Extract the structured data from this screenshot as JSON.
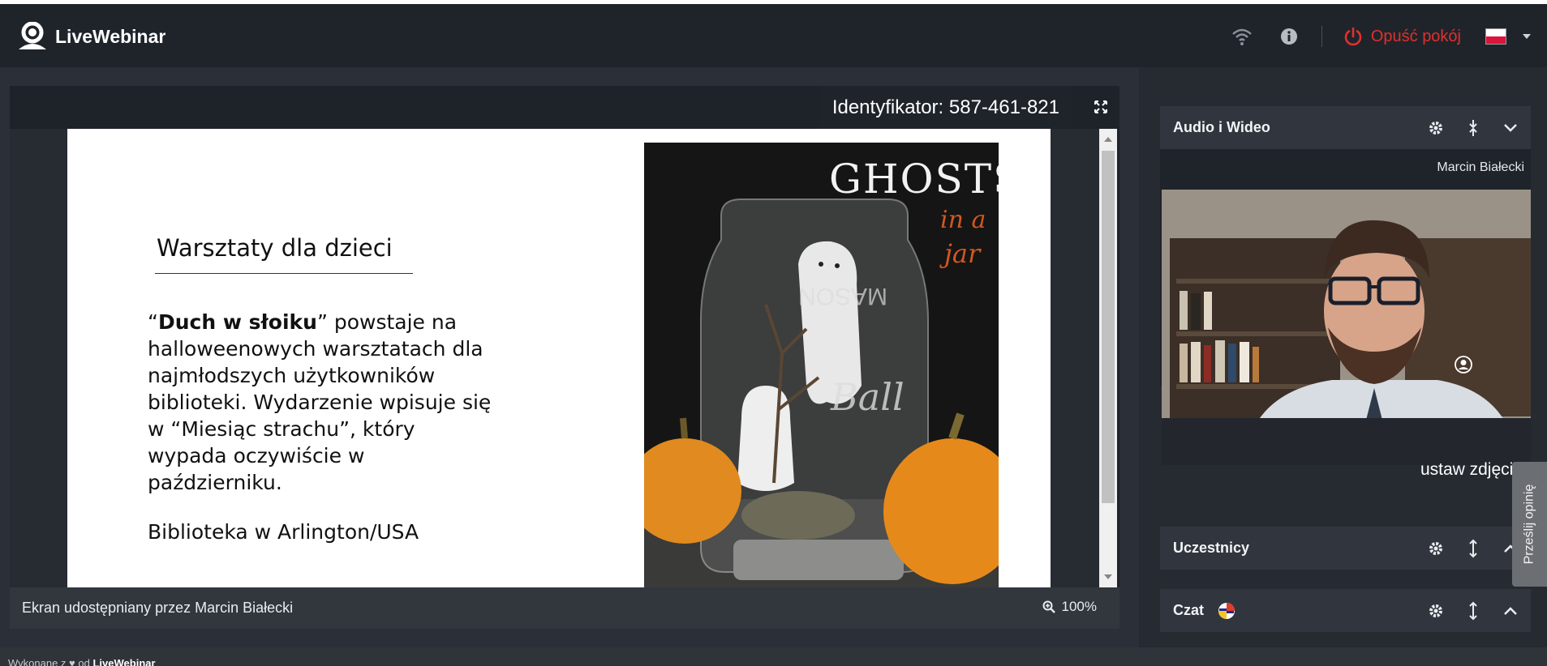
{
  "app": {
    "logo_text": "LiveWebinar"
  },
  "topbar": {
    "leave_label": "Opuść pokój",
    "language": "pl",
    "icons": [
      "wifi-icon",
      "info-icon",
      "power-icon",
      "flag-icon",
      "caret-down-icon"
    ]
  },
  "stage": {
    "room_id_label": "Identyfikator: 587-461-821",
    "shared_by": "Ekran udostępniany przez Marcin Białecki",
    "zoom_level": "100%"
  },
  "slide": {
    "title": "Warsztaty dla dzieci",
    "body_bold": "Duch w słoiku",
    "body_rest": "” powstaje na halloweenowych warsztatach dla najmłodszych użytkowników biblioteki. Wydarzenie wpisuje się w “Miesiąc strachu”, który wypada oczywiście w październiku.",
    "body_open_quote": "“",
    "footer": "Biblioteka w Arlington/USA",
    "photo_caption_1": "GHOSTS",
    "photo_caption_2": "in a",
    "photo_caption_3": "jar",
    "jar_text": "MASON",
    "jar_brand": "Ball"
  },
  "panels": {
    "audio_video": {
      "title": "Audio i Wideo",
      "participant_name": "Marcin Białecki",
      "set_photo_label": "ustaw zdjęcie"
    },
    "participants": {
      "title": "Uczestnicy"
    },
    "chat": {
      "title": "Czat"
    }
  },
  "feedback_label": "Prześlij opinię",
  "footer": {
    "prefix": "Wykonane z",
    "suffix": "od",
    "brand": "LiveWebinar"
  }
}
